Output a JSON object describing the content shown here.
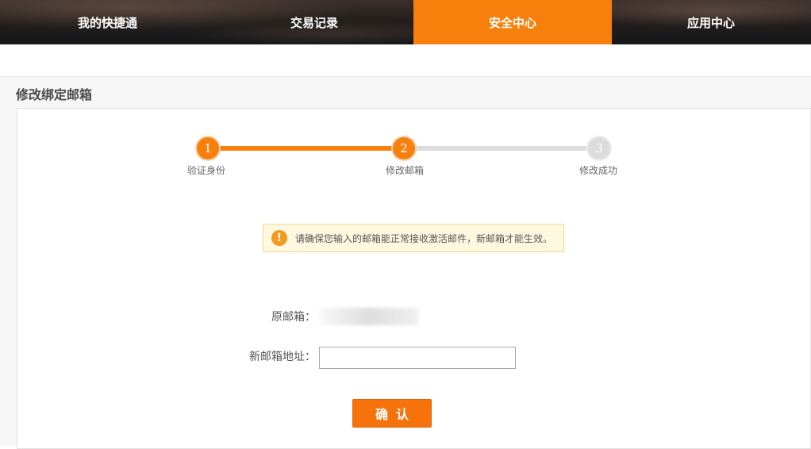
{
  "nav": {
    "items": [
      {
        "label": "我的快捷通",
        "active": false
      },
      {
        "label": "交易记录",
        "active": false
      },
      {
        "label": "安全中心",
        "active": true
      },
      {
        "label": "应用中心",
        "active": false
      }
    ]
  },
  "page": {
    "title": "修改绑定邮箱"
  },
  "steps": {
    "current": 2,
    "items": [
      {
        "number": "1",
        "label": "验证身份"
      },
      {
        "number": "2",
        "label": "修改邮箱"
      },
      {
        "number": "3",
        "label": "修改成功"
      }
    ]
  },
  "notice": {
    "icon": "exclamation-icon",
    "text": "请确保您输入的邮箱能正常接收激活邮件，新邮箱才能生效。"
  },
  "form": {
    "old_email_label": "原邮箱：",
    "old_email_value": "",
    "new_email_label": "新邮箱地址：",
    "new_email_value": "",
    "new_email_placeholder": "",
    "submit_label": "确认"
  },
  "colors": {
    "accent": "#f77f0c",
    "inactive_step": "#dddddd",
    "notice_bg": "#fff8e1",
    "notice_border": "#f0d78a"
  }
}
